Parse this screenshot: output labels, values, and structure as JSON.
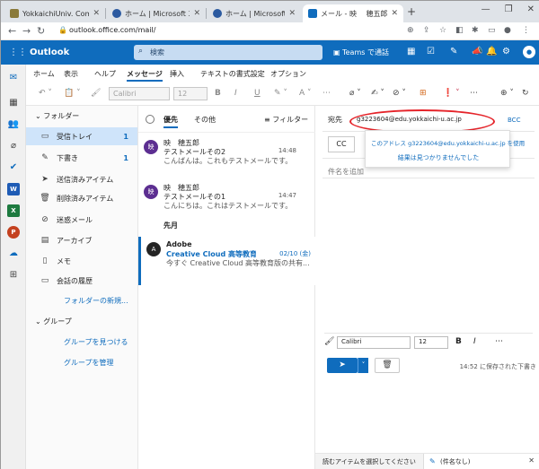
{
  "browser": {
    "tabs": [
      {
        "title": "YokkaichiUniv. Compute",
        "favicon_color": "#8a7a3a"
      },
      {
        "title": "ホーム | Microsoft 365",
        "favicon_color": "#2c5aa0"
      },
      {
        "title": "ホーム | Microsoft 365",
        "favicon_color": "#2c5aa0"
      },
      {
        "title": "メール - 映 　穂五郎 - Out",
        "favicon_color": "#0f6cbd"
      }
    ],
    "new_tab": "+",
    "url": "outlook.office.com/mail/",
    "window_controls": [
      "—",
      "❐",
      "✕"
    ]
  },
  "header": {
    "brand": "Outlook",
    "search_placeholder": "検索",
    "teams_label": "Teams で通話"
  },
  "ribbon": {
    "tabs": [
      "ホーム",
      "表示",
      "ヘルプ",
      "メッセージ",
      "挿入",
      "テキストの書式設定",
      "オプション"
    ],
    "selected_tab": "メッセージ",
    "font": "Calibri",
    "size": "12"
  },
  "folders": {
    "section": "フォルダー",
    "items": [
      {
        "label": "受信トレイ",
        "count": "1",
        "icon": "inbox-icon"
      },
      {
        "label": "下書き",
        "count": "1",
        "icon": "pencil-icon"
      },
      {
        "label": "送信済みアイテム",
        "count": "",
        "icon": "send-icon"
      },
      {
        "label": "削除済みアイテム",
        "count": "",
        "icon": "trash-icon"
      },
      {
        "label": "迷惑メール",
        "count": "",
        "icon": "junk-icon"
      },
      {
        "label": "アーカイブ",
        "count": "",
        "icon": "archive-icon"
      },
      {
        "label": "メモ",
        "count": "",
        "icon": "note-icon"
      },
      {
        "label": "会話の履歴",
        "count": "",
        "icon": "folder-icon"
      }
    ],
    "new_folder": "フォルダーの新規...",
    "groups_section": "グループ",
    "find_groups": "グループを見つける",
    "manage_groups": "グループを管理"
  },
  "message_list": {
    "tab_focused": "優先",
    "tab_other": "その他",
    "filter": "フィルター",
    "section_last_month": "先月",
    "messages": [
      {
        "from": "映　穂五郎",
        "subject": "テストメールその2",
        "preview": "こんばんは。これもテストメールです。",
        "time": "14:48",
        "avatar": "映"
      },
      {
        "from": "映　穂五郎",
        "subject": "テストメールその1",
        "preview": "こんにちは。これはテストメールです。",
        "time": "14:47",
        "avatar": "映"
      },
      {
        "from": "Adobe",
        "subject": "Creative Cloud 高等教育版...",
        "preview": "今すぐ Creative Cloud 高等教育版の共有...",
        "time": "02/10 (金)",
        "avatar": "A"
      }
    ]
  },
  "compose": {
    "to_label": "宛先",
    "to_value": "g3223604@edu.yokkaichi-u.ac.jp",
    "bcc_label": "BCC",
    "cc_label": "CC",
    "subject_placeholder": "件名を追加",
    "suggestion_use": "このアドレス g3223604@edu.yokkaichi-u.ac.jp を使用",
    "suggestion_none": "結果は見つかりませんでした",
    "font": "Calibri",
    "size": "12",
    "saved_status": "14:52 に保存された下書き"
  },
  "bottom": {
    "left_text": "読むアイテムを選択してください",
    "draft_title": "(件名なし)"
  },
  "colors": {
    "accent": "#0f6cbd",
    "highlight_ellipse": "#e5242a"
  }
}
